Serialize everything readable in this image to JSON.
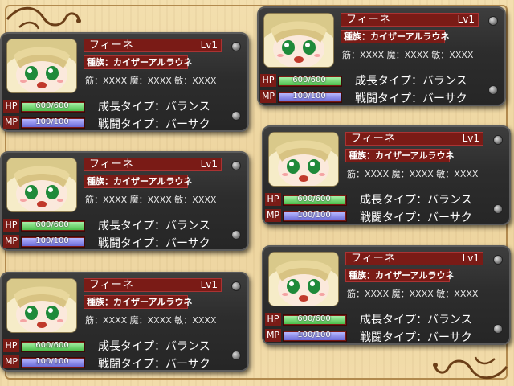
{
  "colors": {
    "panel": "#2d2d2d",
    "plate": "#7a1b16",
    "hp": "#4cbf4c",
    "mp": "#6a6ad8",
    "background": "#ecd39d"
  },
  "cards": [
    {
      "name": "フィーネ",
      "level": "Lv1",
      "race": "種族：カイザーアルラウネ",
      "stats": "筋：XXXX 魔：XXXX 敏：XXXX",
      "hp": "600/600",
      "mp": "100/100",
      "hp_fraction": 1.0,
      "mp_fraction": 1.0,
      "growth": "成長タイプ：バランス",
      "battle": "戦闘タイプ：バーサク"
    },
    {
      "name": "フィーネ",
      "level": "Lv1",
      "race": "種族：カイザーアルラウネ",
      "stats": "筋：XXXX 魔：XXXX 敏：XXXX",
      "hp": "600/600",
      "mp": "100/100",
      "hp_fraction": 1.0,
      "mp_fraction": 1.0,
      "growth": "成長タイプ：バランス",
      "battle": "戦闘タイプ：バーサク"
    },
    {
      "name": "フィーネ",
      "level": "Lv1",
      "race": "種族：カイザーアルラウネ",
      "stats": "筋：XXXX 魔：XXXX 敏：XXXX",
      "hp": "600/600",
      "mp": "100/100",
      "hp_fraction": 1.0,
      "mp_fraction": 1.0,
      "growth": "成長タイプ：バランス",
      "battle": "戦闘タイプ：バーサク"
    },
    {
      "name": "フィーネ",
      "level": "Lv1",
      "race": "種族：カイザーアルラウネ",
      "stats": "筋：XXXX 魔：XXXX 敏：XXXX",
      "hp": "600/600",
      "mp": "100/100",
      "hp_fraction": 1.0,
      "mp_fraction": 1.0,
      "growth": "成長タイプ：バランス",
      "battle": "戦闘タイプ：バーサク"
    },
    {
      "name": "フィーネ",
      "level": "Lv1",
      "race": "種族：カイザーアルラウネ",
      "stats": "筋：XXXX 魔：XXXX 敏：XXXX",
      "hp": "600/600",
      "mp": "100/100",
      "hp_fraction": 1.0,
      "mp_fraction": 1.0,
      "growth": "成長タイプ：バランス",
      "battle": "戦闘タイプ：バーサク"
    },
    {
      "name": "フィーネ",
      "level": "Lv1",
      "race": "種族：カイザーアルラウネ",
      "stats": "筋：XXXX 魔：XXXX 敏：XXXX",
      "hp": "600/600",
      "mp": "100/100",
      "hp_fraction": 1.0,
      "mp_fraction": 1.0,
      "growth": "成長タイプ：バランス",
      "battle": "戦闘タイプ：バーサク"
    }
  ]
}
